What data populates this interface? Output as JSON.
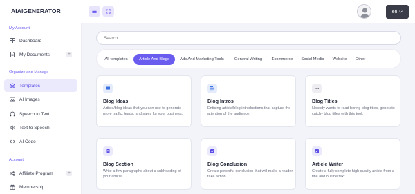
{
  "app": {
    "logo": "AIAIGENERATOR"
  },
  "header": {
    "menu_icon": "hamburger-icon",
    "expand_icon": "fullscreen-icon",
    "avatar_icon": "user-avatar-icon",
    "language": "en",
    "accent": "#6b5cf0"
  },
  "sidebar": {
    "sections": [
      {
        "label": "My Account"
      },
      {
        "label": "Organize and Manage"
      },
      {
        "label": "Account"
      }
    ],
    "items": [
      {
        "label": "Dashboard",
        "icon": "grid-icon"
      },
      {
        "label": "My Documents",
        "icon": "document-icon",
        "plus": "+"
      },
      {
        "label": "Templates",
        "icon": "layers-icon",
        "active": true
      },
      {
        "label": "AI Images",
        "icon": "image-icon"
      },
      {
        "label": "Speech to Text",
        "icon": "headphones-icon"
      },
      {
        "label": "Text to Speech",
        "icon": "speaker-icon"
      },
      {
        "label": "AI Code",
        "icon": "code-icon"
      },
      {
        "label": "Affiliate Program",
        "icon": "share-icon",
        "plus": "+"
      },
      {
        "label": "Membership",
        "icon": "gift-icon"
      }
    ]
  },
  "search": {
    "placeholder": "Search..."
  },
  "tabs": [
    {
      "label": "All templates"
    },
    {
      "label": "Article And Blogs",
      "active": true
    },
    {
      "label": "Ads And Marketing Tools"
    },
    {
      "label": "General Writing"
    },
    {
      "label": "Ecommerce"
    },
    {
      "label": "Social Media"
    },
    {
      "label": "Website"
    },
    {
      "label": "Other"
    }
  ],
  "cards": [
    {
      "title": "Blog Ideas",
      "description": "Article/blog ideas that you can use to generate more traffic, leads, and sales for your business.",
      "icon": "chat-bubble-icon",
      "color": "#3a6fe0",
      "bg": "#e4ecfc"
    },
    {
      "title": "Blog Intros",
      "description": "Enticing article/blog introductions that capture the attention of the audience.",
      "icon": "text-lines-icon",
      "color": "#3a6fe0",
      "bg": "#e4ecfc"
    },
    {
      "title": "Blog Titles",
      "description": "Nobody wants to read boring blog titles, generate catchy blog titles with this tool.",
      "icon": "ellipsis-icon",
      "color": "#3b3e4d",
      "bg": "#eeeef2"
    },
    {
      "title": "Blog Section",
      "description": "Write a few paragraphs about a subheading of your article.",
      "icon": "book-icon",
      "color": "#5b4de6",
      "bg": "#ebe9fc"
    },
    {
      "title": "Blog Conclusion",
      "description": "Create powerful conclusion that will make a reader take action.",
      "icon": "checkbox-icon",
      "color": "#5b4de6",
      "bg": "#ebe9fc"
    },
    {
      "title": "Article Writer",
      "description": "Create a fully complete high quality article from a title and outline text.",
      "icon": "edit-icon",
      "color": "#5b4de6",
      "bg": "#ebe9fc"
    }
  ]
}
